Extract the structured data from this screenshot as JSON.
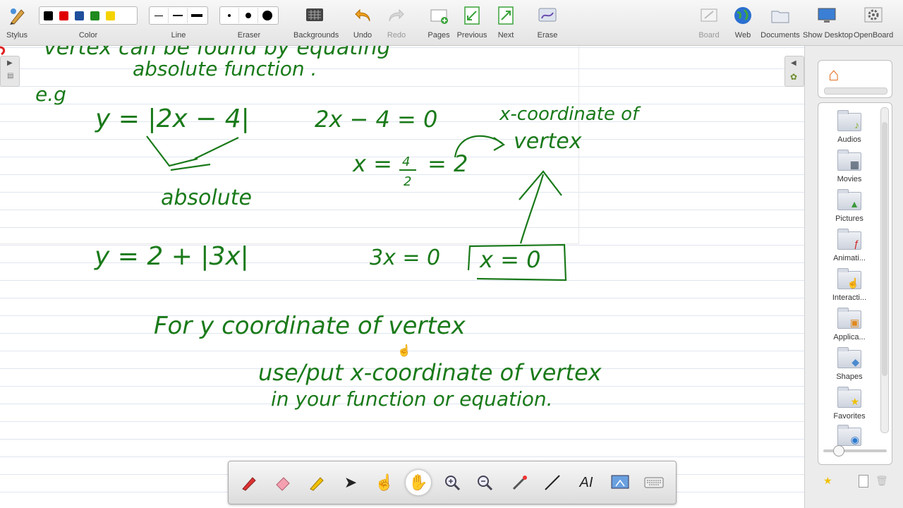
{
  "toolbar": {
    "stylus": "Stylus",
    "color": "Color",
    "line": "Line",
    "eraser": "Eraser",
    "backgrounds": "Backgrounds",
    "undo": "Undo",
    "redo": "Redo",
    "pages": "Pages",
    "previous": "Previous",
    "next": "Next",
    "erase": "Erase",
    "board": "Board",
    "web": "Web",
    "documents": "Documents",
    "show_desktop": "Show Desktop",
    "openboard": "OpenBoard",
    "colors": [
      "#000000",
      "#e00000",
      "#1f4e9c",
      "#1e8a1e",
      "#f5d300"
    ]
  },
  "board": {
    "ink_color": "#1a7a1a",
    "line1": "vertex can be found by equating",
    "line2": "absolute function .",
    "eg": "e.g",
    "eq1": "y = |2x − 4|",
    "absolute": "absolute",
    "eq2": "2x − 4 = 0",
    "eq3a": "x =",
    "eq3num": "4",
    "eq3den": "2",
    "eq3b": "= 2",
    "xcoord": "x-coordinate of",
    "vertex": "vertex",
    "eq4": "y =  2 + |3x|",
    "eq5": "3x = 0",
    "boxed": "x = 0",
    "for_y": "For  y coordinate  of  vertex",
    "use_put": "use/put  x-coordinate of vertex",
    "in_your": "in your function or equation."
  },
  "library": {
    "items": [
      "Audios",
      "Movies",
      "Pictures",
      "Animati...",
      "Interacti...",
      "Applica...",
      "Shapes",
      "Favorites"
    ]
  }
}
